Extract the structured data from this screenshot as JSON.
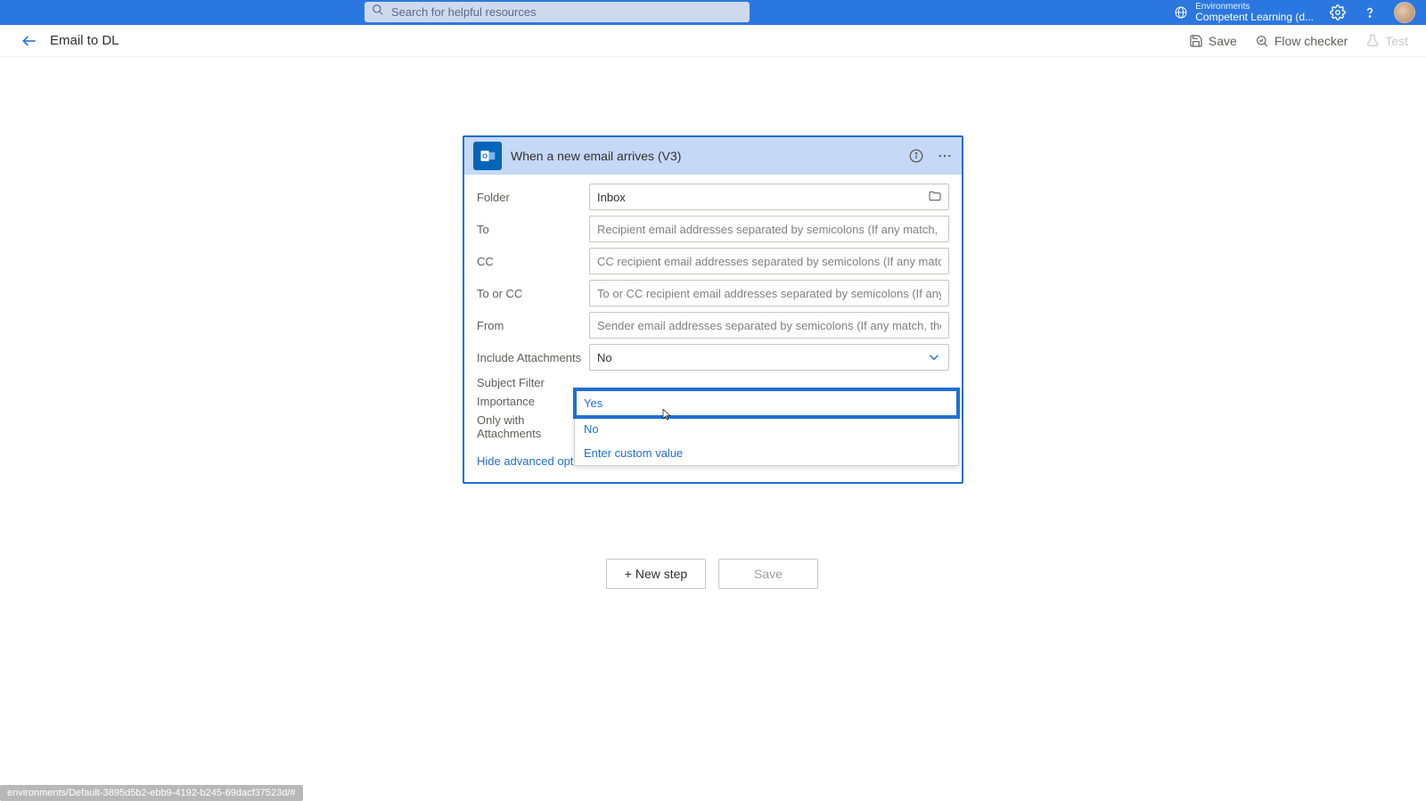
{
  "topbar": {
    "search_placeholder": "Search for helpful resources",
    "env_label": "Environments",
    "env_name": "Competent Learning (d..."
  },
  "subbar": {
    "flow_name": "Email to DL",
    "save": "Save",
    "flow_checker": "Flow checker",
    "test": "Test"
  },
  "card": {
    "title": "When a new email arrives (V3)",
    "fields": {
      "folder_label": "Folder",
      "folder_value": "Inbox",
      "to_label": "To",
      "to_placeholder": "Recipient email addresses separated by semicolons (If any match, the",
      "cc_label": "CC",
      "cc_placeholder": "CC recipient email addresses separated by semicolons (If any match,",
      "toorcc_label": "To or CC",
      "toorcc_placeholder": "To or CC recipient email addresses separated by semicolons (If any m",
      "from_label": "From",
      "from_placeholder": "Sender email addresses separated by semicolons (If any match, the t",
      "include_att_label": "Include Attachments",
      "include_att_value": "No",
      "subject_filter_label": "Subject Filter",
      "importance_label": "Importance",
      "only_att_label": "Only with Attachments"
    },
    "adv_link": "Hide advanced options"
  },
  "dropdown": {
    "opt_yes": "Yes",
    "opt_no": "No",
    "opt_custom": "Enter custom value"
  },
  "buttons": {
    "new_step": "+ New step",
    "save": "Save"
  },
  "status_url": "environments/Default-3895d5b2-ebb9-4192-b245-69dacf37523d/#"
}
